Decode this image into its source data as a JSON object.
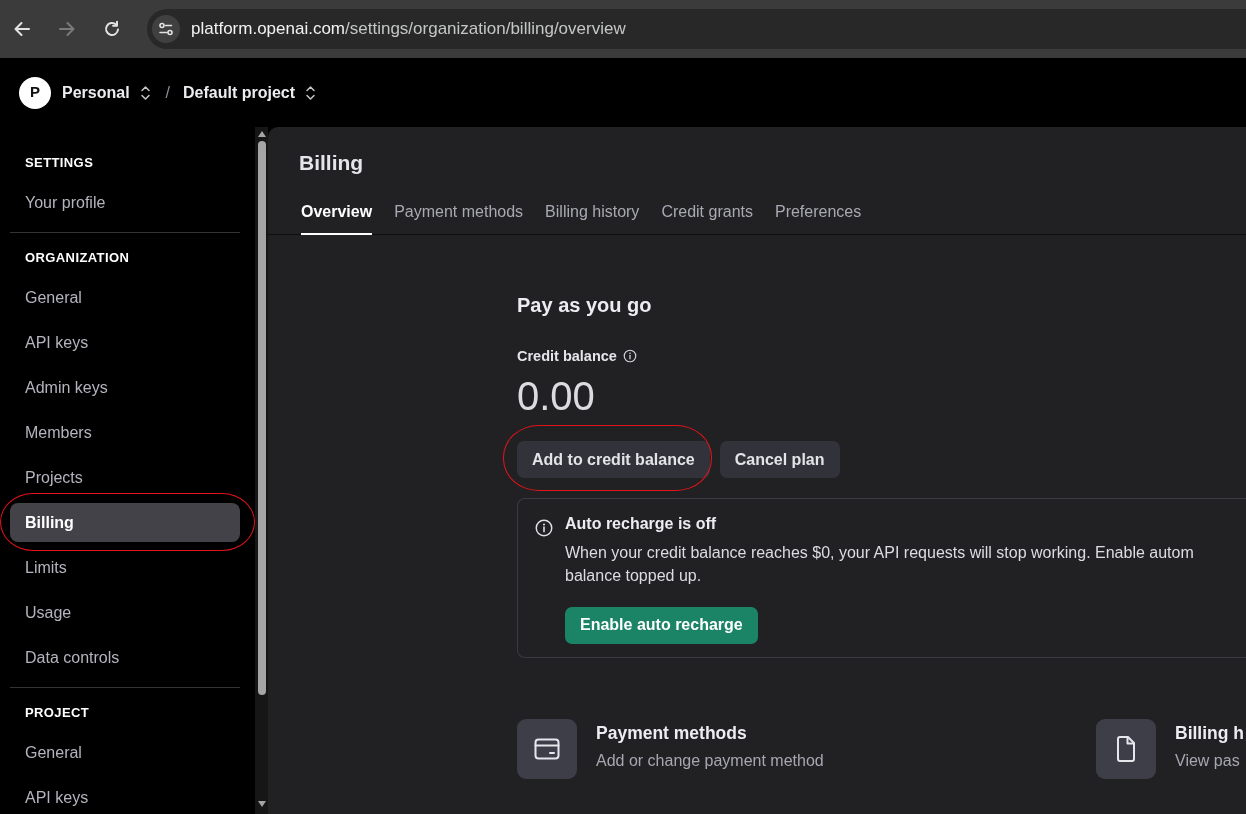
{
  "browser": {
    "nav_buttons": [
      {
        "kind": "back",
        "disabled": false
      },
      {
        "kind": "forward",
        "disabled": true
      },
      {
        "kind": "reload",
        "disabled": false
      }
    ],
    "url": {
      "host": "platform.openai.com",
      "path": "/settings/organization/billing/overview"
    }
  },
  "header": {
    "avatar": "P",
    "organization": "Personal",
    "separator": "/",
    "project": "Default project"
  },
  "sidebar": {
    "sections": [
      {
        "title": "SETTINGS",
        "items": [
          {
            "label": "Your profile",
            "selected": false,
            "circled": false
          }
        ]
      },
      {
        "title": "ORGANIZATION",
        "items": [
          {
            "label": "General",
            "selected": false,
            "circled": false
          },
          {
            "label": "API keys",
            "selected": false,
            "circled": false
          },
          {
            "label": "Admin keys",
            "selected": false,
            "circled": false
          },
          {
            "label": "Members",
            "selected": false,
            "circled": false
          },
          {
            "label": "Projects",
            "selected": false,
            "circled": false
          },
          {
            "label": "Billing",
            "selected": true,
            "circled": true
          },
          {
            "label": "Limits",
            "selected": false,
            "circled": false
          },
          {
            "label": "Usage",
            "selected": false,
            "circled": false
          },
          {
            "label": "Data controls",
            "selected": false,
            "circled": false
          }
        ]
      },
      {
        "title": "PROJECT",
        "items": [
          {
            "label": "General",
            "selected": false,
            "circled": false
          },
          {
            "label": "API keys",
            "selected": false,
            "circled": false
          }
        ]
      }
    ]
  },
  "page": {
    "title": "Billing",
    "tabs": [
      {
        "label": "Overview",
        "selected": true
      },
      {
        "label": "Payment methods",
        "selected": false
      },
      {
        "label": "Billing history",
        "selected": false
      },
      {
        "label": "Credit grants",
        "selected": false
      },
      {
        "label": "Preferences",
        "selected": false
      }
    ],
    "plan": "Pay as you go",
    "balance_label": "Credit balance",
    "balance": "0.00",
    "actions": [
      {
        "label": "Add to credit balance",
        "circled": true
      },
      {
        "label": "Cancel plan",
        "circled": false
      }
    ],
    "notice": {
      "title": "Auto recharge is off",
      "lines": [
        "When your credit balance reaches $0, your API requests will stop working. Enable autom",
        "balance topped up."
      ],
      "action": "Enable auto recharge"
    },
    "shortcuts": [
      {
        "kind": "card",
        "title": "Payment methods",
        "description": "Add or change payment method"
      },
      {
        "kind": "document",
        "title": "Billing h",
        "description": "View pas"
      }
    ]
  }
}
